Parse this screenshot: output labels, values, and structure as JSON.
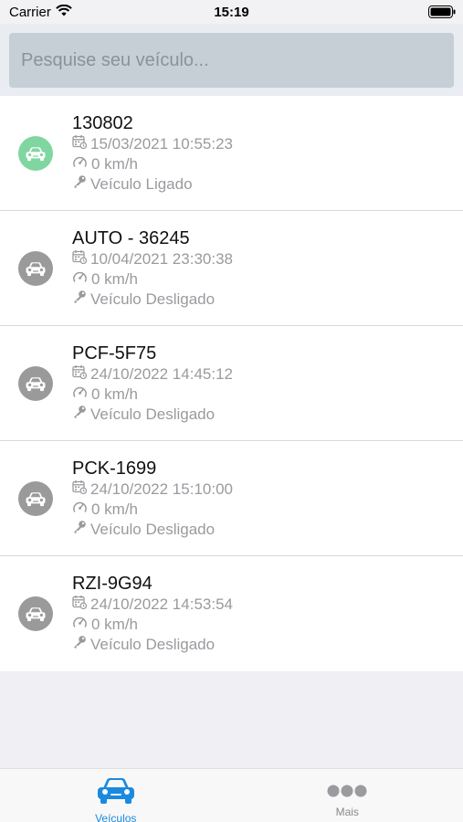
{
  "status": {
    "carrier": "Carrier",
    "time": "15:19"
  },
  "search": {
    "placeholder": "Pesquise seu veículo..."
  },
  "colors": {
    "online": "#7fd6a0",
    "offline": "#9a9a9a",
    "accent": "#1a8ae0"
  },
  "vehicles": [
    {
      "plate": "130802",
      "datetime": "15/03/2021 10:55:23",
      "speed": "0 km/h",
      "status": "Veículo Ligado",
      "state": "on"
    },
    {
      "plate": "AUTO - 36245",
      "datetime": "10/04/2021 23:30:38",
      "speed": "0 km/h",
      "status": "Veículo Desligado",
      "state": "off"
    },
    {
      "plate": "PCF-5F75",
      "datetime": "24/10/2022 14:45:12",
      "speed": "0 km/h",
      "status": "Veículo Desligado",
      "state": "off"
    },
    {
      "plate": "PCK-1699",
      "datetime": "24/10/2022 15:10:00",
      "speed": "0 km/h",
      "status": "Veículo Desligado",
      "state": "off"
    },
    {
      "plate": "RZI-9G94",
      "datetime": "24/10/2022 14:53:54",
      "speed": "0 km/h",
      "status": "Veículo Desligado",
      "state": "off"
    }
  ],
  "tabs": [
    {
      "label": "Veículos",
      "icon": "car-icon",
      "active": true
    },
    {
      "label": "Mais",
      "icon": "more-icon",
      "active": false
    }
  ]
}
